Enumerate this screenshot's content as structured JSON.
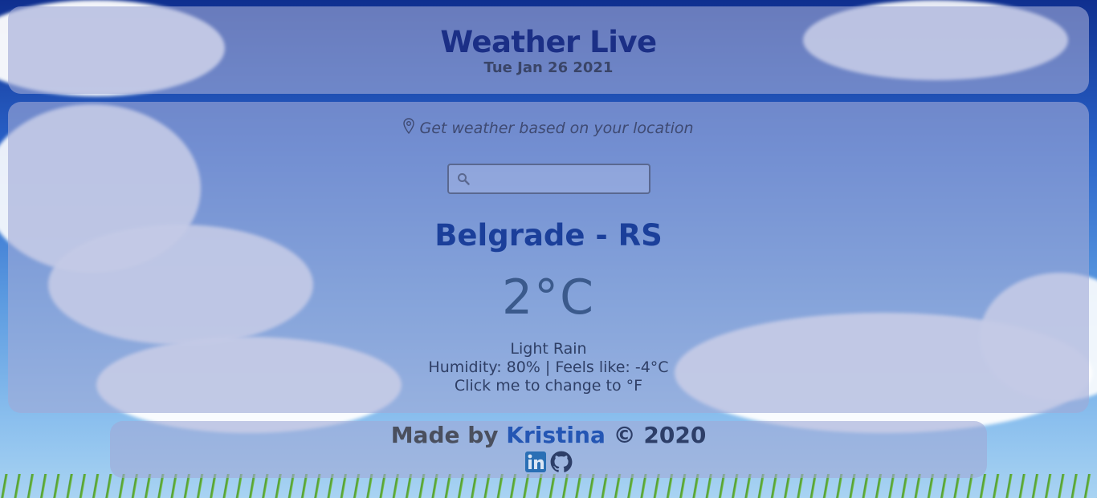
{
  "header": {
    "title": "Weather Live",
    "date": "Tue Jan 26 2021"
  },
  "main": {
    "location_link": "Get weather based on your location",
    "search": {
      "value": "",
      "placeholder": ""
    },
    "city": "Belgrade - RS",
    "temperature": "2°C",
    "condition": "Light Rain",
    "humidity_feels": "Humidity: 80% | Feels like: -4°C",
    "unit_toggle": "Click me to change to °F"
  },
  "footer": {
    "made_by": "Made by ",
    "author": "Kristina",
    "copyright": " © 2020",
    "icons": [
      "linkedin-icon",
      "github-icon"
    ]
  },
  "colors": {
    "panel": "#a0aad7",
    "title": "#1b2f86",
    "city": "#1b3f9a",
    "link": "#2456b4"
  }
}
